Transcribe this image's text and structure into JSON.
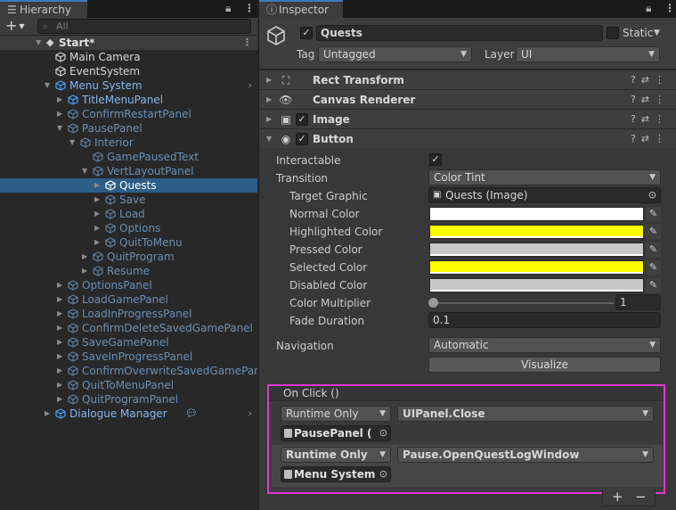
{
  "hierarchy": {
    "tab_label": "Hierarchy",
    "search_placeholder": "All",
    "scene_name": "Start*",
    "items": [
      {
        "label": "Main Camera",
        "indent": 1,
        "style": "white",
        "arrow": ""
      },
      {
        "label": "EventSystem",
        "indent": 1,
        "style": "white",
        "arrow": ""
      },
      {
        "label": "Menu System",
        "indent": 1,
        "style": "blue",
        "arrow": "down",
        "chevron": true
      },
      {
        "label": "TitleMenuPanel",
        "indent": 2,
        "style": "blue",
        "arrow": "right"
      },
      {
        "label": "ConfirmRestartPanel",
        "indent": 2,
        "style": "dim",
        "arrow": "right"
      },
      {
        "label": "PausePanel",
        "indent": 2,
        "style": "dim",
        "arrow": "down"
      },
      {
        "label": "Interior",
        "indent": 3,
        "style": "dim",
        "arrow": "down"
      },
      {
        "label": "GamePausedText",
        "indent": 4,
        "style": "dim",
        "arrow": ""
      },
      {
        "label": "VertLayoutPanel",
        "indent": 4,
        "style": "dim",
        "arrow": "down"
      },
      {
        "label": "Quests",
        "indent": 5,
        "style": "blue",
        "arrow": "right",
        "selected": true
      },
      {
        "label": "Save",
        "indent": 5,
        "style": "dim",
        "arrow": "right"
      },
      {
        "label": "Load",
        "indent": 5,
        "style": "dim",
        "arrow": "right"
      },
      {
        "label": "Options",
        "indent": 5,
        "style": "dim",
        "arrow": "right"
      },
      {
        "label": "QuitToMenu",
        "indent": 5,
        "style": "dim",
        "arrow": "right"
      },
      {
        "label": "QuitProgram",
        "indent": 4,
        "style": "dim",
        "arrow": "right"
      },
      {
        "label": "Resume",
        "indent": 4,
        "style": "dim",
        "arrow": "right"
      },
      {
        "label": "OptionsPanel",
        "indent": 2,
        "style": "dim",
        "arrow": "right"
      },
      {
        "label": "LoadGamePanel",
        "indent": 2,
        "style": "dim",
        "arrow": "right"
      },
      {
        "label": "LoadInProgressPanel",
        "indent": 2,
        "style": "dim",
        "arrow": "right"
      },
      {
        "label": "ConfirmDeleteSavedGamePanel",
        "indent": 2,
        "style": "dim",
        "arrow": "right"
      },
      {
        "label": "SaveGamePanel",
        "indent": 2,
        "style": "dim",
        "arrow": "right"
      },
      {
        "label": "SaveInProgressPanel",
        "indent": 2,
        "style": "dim",
        "arrow": "right"
      },
      {
        "label": "ConfirmOverwriteSavedGamePanel",
        "indent": 2,
        "style": "dim",
        "arrow": "right"
      },
      {
        "label": "QuitToMenuPanel",
        "indent": 2,
        "style": "dim",
        "arrow": "right"
      },
      {
        "label": "QuitProgramPanel",
        "indent": 2,
        "style": "dim",
        "arrow": "right"
      },
      {
        "label": "Dialogue Manager",
        "indent": 1,
        "style": "blue",
        "arrow": "right",
        "chevron": true,
        "badge": true
      }
    ]
  },
  "inspector": {
    "tab_label": "Inspector",
    "object_name": "Quests",
    "static_label": "Static",
    "tag_label": "Tag",
    "tag_value": "Untagged",
    "layer_label": "Layer",
    "layer_value": "UI",
    "components": [
      {
        "title": "Rect Transform",
        "has_checkbox": false,
        "icon": "rect-transform-icon"
      },
      {
        "title": "Canvas Renderer",
        "has_checkbox": false,
        "icon": "eye-icon"
      },
      {
        "title": "Image",
        "has_checkbox": true,
        "icon": "image-icon"
      },
      {
        "title": "Button",
        "has_checkbox": true,
        "icon": "button-icon"
      }
    ],
    "button": {
      "interactable_label": "Interactable",
      "transition_label": "Transition",
      "transition_value": "Color Tint",
      "target_graphic_label": "Target Graphic",
      "target_graphic_value": "Quests (Image)",
      "colors": [
        {
          "label": "Normal Color",
          "color": "#ffffff"
        },
        {
          "label": "Highlighted Color",
          "color": "#ffff00"
        },
        {
          "label": "Pressed Color",
          "color": "#c8c8c8"
        },
        {
          "label": "Selected Color",
          "color": "#ffff00"
        },
        {
          "label": "Disabled Color",
          "color": "#c8c8c8"
        }
      ],
      "color_multiplier_label": "Color Multiplier",
      "color_multiplier_value": "1",
      "fade_duration_label": "Fade Duration",
      "fade_duration_value": "0.1",
      "navigation_label": "Navigation",
      "navigation_value": "Automatic",
      "visualize_label": "Visualize"
    },
    "on_click": {
      "title": "On Click ()",
      "events": [
        {
          "mode": "Runtime Only",
          "function": "UIPanel.Close",
          "object": "PausePanel (",
          "bold": false
        },
        {
          "mode": "Runtime Only",
          "function": "Pause.OpenQuestLogWindow",
          "object": "Menu System",
          "bold": true
        }
      ],
      "add_label": "+",
      "remove_label": "−"
    }
  }
}
